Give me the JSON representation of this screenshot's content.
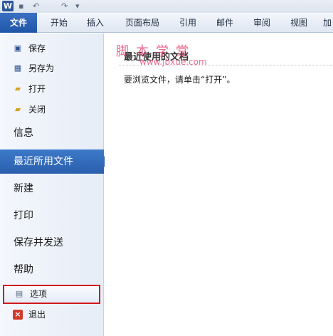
{
  "app": {
    "icon": "W"
  },
  "quick_access": {
    "undo": "↶",
    "redo": "↷",
    "more": "▾"
  },
  "ribbon": {
    "tabs": [
      {
        "label": "文件"
      },
      {
        "label": "开始"
      },
      {
        "label": "插入"
      },
      {
        "label": "页面布局"
      },
      {
        "label": "引用"
      },
      {
        "label": "邮件"
      },
      {
        "label": "审阅"
      },
      {
        "label": "视图"
      },
      {
        "label": "加"
      }
    ]
  },
  "backstage": {
    "commands": [
      {
        "label": "保存",
        "icon": "save-icon"
      },
      {
        "label": "另存为",
        "icon": "save-as-icon"
      },
      {
        "label": "打开",
        "icon": "open-folder-icon"
      },
      {
        "label": "关闭",
        "icon": "close-folder-icon"
      }
    ],
    "sections": [
      {
        "label": "信息"
      },
      {
        "label": "最近所用文件"
      },
      {
        "label": "新建"
      },
      {
        "label": "打印"
      },
      {
        "label": "保存并发送"
      },
      {
        "label": "帮助"
      }
    ],
    "options_label": "选项",
    "exit_label": "退出"
  },
  "main": {
    "heading": "最近使用的文档",
    "hint": "要浏览文件，请单击“打开”。"
  },
  "watermark": {
    "title": "脚本学堂",
    "url": "www.jbxue.com"
  },
  "colors": {
    "accent": "#2a5fad",
    "highlight_border": "#d2171a",
    "watermark": "#e33a6a"
  }
}
